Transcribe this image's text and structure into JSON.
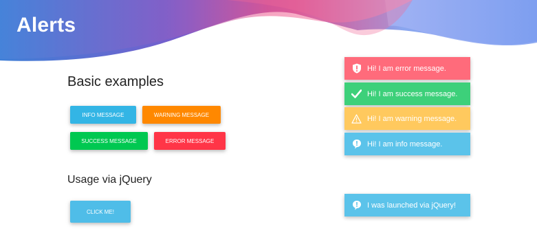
{
  "header": {
    "title": "Alerts"
  },
  "sections": {
    "basic": "Basic examples",
    "jquery": "Usage via jQuery"
  },
  "buttons": {
    "info": "Info message",
    "warning": "Warning message",
    "success": "Success message",
    "error": "Error message",
    "click": "Click me!"
  },
  "toasts": {
    "error": {
      "text": "Hi! I am error message.",
      "icon": "shield-exclamation-icon",
      "color": "#ff6b7b"
    },
    "success": {
      "text": "Hi! I am success message.",
      "icon": "check-icon",
      "color": "#3dd07a"
    },
    "warning": {
      "text": "Hi! I am warning message.",
      "icon": "warning-triangle-icon",
      "color": "#ffc95e"
    },
    "info": {
      "text": "Hi! I am info message.",
      "icon": "info-bubble-icon",
      "color": "#5bc3ea"
    },
    "jquery": {
      "text": "I was launched via jQuery!",
      "icon": "info-bubble-icon",
      "color": "#5bc3ea"
    }
  },
  "colors": {
    "info": "#33b5e5",
    "warning": "#ff8800",
    "success": "#00c851",
    "error": "#ff3547"
  }
}
